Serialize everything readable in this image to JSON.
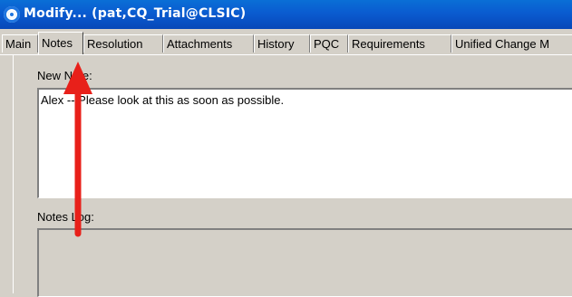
{
  "window": {
    "title": "Modify... (pat,CQ_Trial@CLSIC)",
    "icon": "clearquest-swirl-icon"
  },
  "tabs": [
    {
      "label": "Main",
      "mnemonic": "M",
      "active": false
    },
    {
      "label": "Notes",
      "mnemonic": "",
      "active": true
    },
    {
      "label": "Resolution",
      "mnemonic": "R",
      "active": false
    },
    {
      "label": "Attachments",
      "mnemonic": "A",
      "active": false
    },
    {
      "label": "History",
      "mnemonic": "H",
      "active": false
    },
    {
      "label": "PQC",
      "mnemonic": "",
      "active": false
    },
    {
      "label": "Requirements",
      "mnemonic": "",
      "active": false
    },
    {
      "label": "Unified Change M",
      "mnemonic": "",
      "active": false
    }
  ],
  "notes": {
    "new_note_label": "New Note:",
    "new_note_value": "Alex -- Please look at this as soon as possible.",
    "notes_log_label": "Notes Log:",
    "notes_log_value": ""
  },
  "annotation": {
    "arrow_color": "#e8201a"
  }
}
